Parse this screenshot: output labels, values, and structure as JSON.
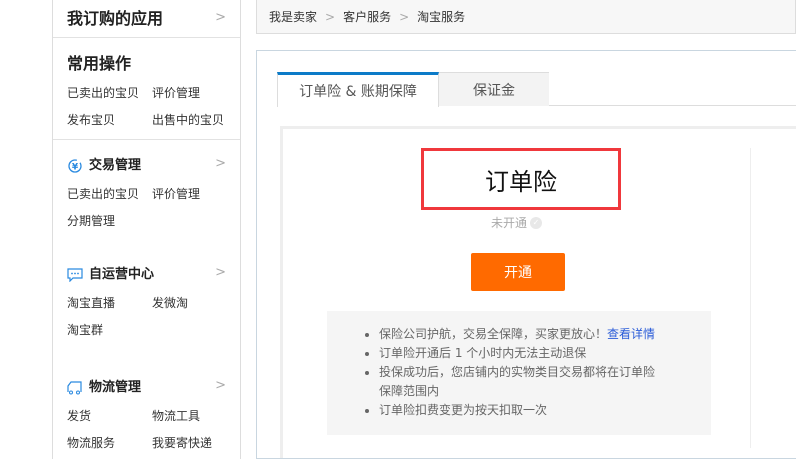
{
  "sidebar": {
    "subscribed": {
      "title": "我订购的应用"
    },
    "common": {
      "title": "常用操作",
      "links": [
        "已卖出的宝贝",
        "评价管理",
        "发布宝贝",
        "出售中的宝贝"
      ]
    },
    "trade": {
      "title": "交易管理",
      "icon": "yen-circle-icon",
      "links": [
        "已卖出的宝贝",
        "评价管理",
        "分期管理"
      ]
    },
    "self_ops": {
      "title": "自运营中心",
      "icon": "chat-icon",
      "links": [
        "淘宝直播",
        "发微淘",
        "淘宝群"
      ]
    },
    "logistics": {
      "title": "物流管理",
      "icon": "truck-icon",
      "links": [
        "发货",
        "物流工具",
        "物流服务",
        "我要寄快递"
      ]
    },
    "chevron": ">"
  },
  "breadcrumb": {
    "items": [
      "我是卖家",
      "客户服务",
      "淘宝服务"
    ],
    "separator": ">"
  },
  "tabs": [
    {
      "label": "订单险 & 账期保障",
      "active": true
    },
    {
      "label": "保证金",
      "active": false
    }
  ],
  "product": {
    "title": "订单险",
    "status": "未开通",
    "button": "开通",
    "notes": [
      {
        "text": "保险公司护航，交易全保障，买家更放心！",
        "link": "查看详情"
      },
      {
        "text": "订单险开通后 1 个小时内无法主动退保"
      },
      {
        "text": "投保成功后，您店铺内的实物类目交易都将在订单险保障范围内"
      },
      {
        "text": "订单险扣费变更为按天扣取一次"
      }
    ]
  },
  "colors": {
    "accent": "#ff6a00",
    "tab_active": "#0c7bc8",
    "highlight": "#f0383c",
    "link": "#2a5cd8"
  }
}
